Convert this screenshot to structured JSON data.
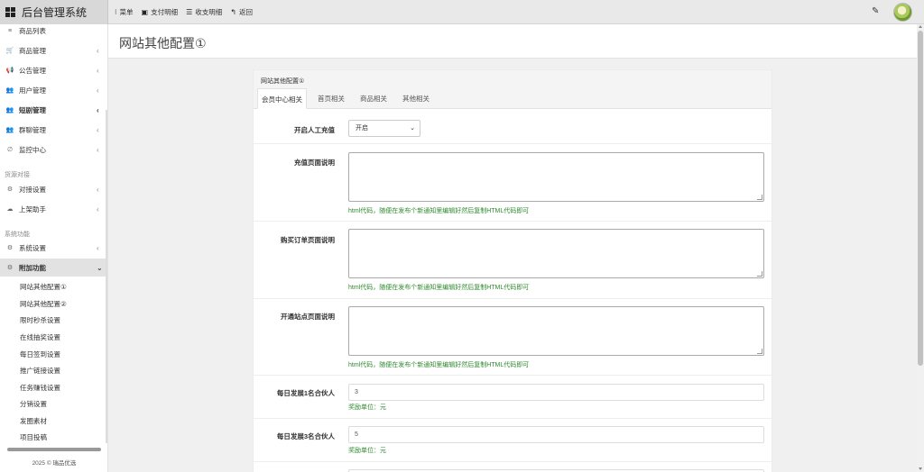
{
  "brand": {
    "title": "后台管理系统"
  },
  "top_nav": [
    {
      "icon": "⁝",
      "label": "菜单"
    },
    {
      "icon": "▣",
      "label": "支付明细"
    },
    {
      "icon": "☰",
      "label": "收支明细"
    },
    {
      "icon": "↰",
      "label": "返回"
    }
  ],
  "sidebar": {
    "items": [
      {
        "label": "商品列表",
        "icon": "≡"
      },
      {
        "label": "商品管理",
        "icon": "🛒",
        "chev": "‹"
      },
      {
        "label": "公告管理",
        "icon": "📢",
        "chev": "‹"
      },
      {
        "label": "用户管理",
        "icon": "👥",
        "chev": "‹"
      },
      {
        "label": "短剧管理",
        "icon": "👥",
        "chev": "‹"
      },
      {
        "label": "群聊管理",
        "icon": "👥",
        "chev": "‹"
      },
      {
        "label": "监控中心",
        "icon": "∅",
        "chev": "‹"
      }
    ],
    "section_dock": "货源对接",
    "dock_items": [
      {
        "label": "对接设置",
        "icon": "⚙",
        "chev": "‹"
      },
      {
        "label": "上架助手",
        "icon": "☁",
        "chev": "‹"
      }
    ],
    "section_system": "系统功能",
    "system_items": [
      {
        "label": "系统设置",
        "icon": "⚙",
        "chev": "‹"
      },
      {
        "label": "附加功能",
        "icon": "⚙",
        "chev": "⌄"
      }
    ],
    "sub_items": [
      "网站其他配置①",
      "网站其他配置②",
      "限时秒杀设置",
      "在线抽奖设置",
      "每日签到设置",
      "推广链接设置",
      "任务赚钱设置",
      "分销设置",
      "发圈素材",
      "项目投稿"
    ],
    "footer": "2025 © 瑞品优选"
  },
  "page": {
    "title": "网站其他配置①"
  },
  "card": {
    "title": "网站其他配置①",
    "tabs": [
      "会员中心相关",
      "首页相关",
      "商品相关",
      "其他相关"
    ]
  },
  "form": {
    "manual_recharge": {
      "label": "开启人工充值",
      "value": "开启"
    },
    "recharge_desc": {
      "label": "充值页面说明",
      "hint": "html代码，随便在发布个新通知里编辑好然后复制HTML代码即可"
    },
    "order_desc": {
      "label": "购买订单页面说明",
      "hint": "html代码，随便在发布个新通知里编辑好然后复制HTML代码即可"
    },
    "site_desc": {
      "label": "开通站点页面说明",
      "hint": "html代码，随便在发布个新通知里编辑好然后复制HTML代码即可"
    },
    "partner1": {
      "label": "每日发展1名合伙人",
      "value": "3",
      "hint": "奖励单位：元"
    },
    "partner3": {
      "label": "每日发展3名合伙人",
      "value": "5",
      "hint": "奖励单位：元"
    }
  }
}
